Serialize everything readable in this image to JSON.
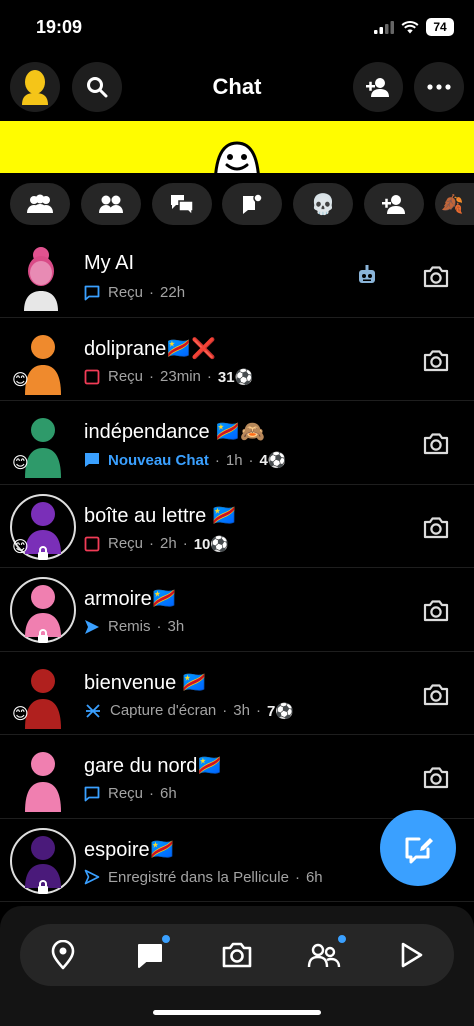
{
  "status_bar": {
    "time": "19:09",
    "battery": "74"
  },
  "header": {
    "title": "Chat"
  },
  "filters": [
    "groups-icon",
    "friends-icon",
    "unread-icon",
    "stories-icon",
    "skull-icon",
    "add-friend-icon",
    "more-filter-icon"
  ],
  "chats": [
    {
      "name": "My AI",
      "status_icon": "received-chat-outline",
      "status": "Reçu",
      "time": "22h",
      "streak": ""
    },
    {
      "name": "dolipranе🇨🇩❌",
      "status_icon": "received-snap-outline",
      "status": "Reçu",
      "time": "23min",
      "streak": "31⚽"
    },
    {
      "name": "indépendance 🇨🇩🙈",
      "status_icon": "new-chat-filled",
      "status": "Nouveau Chat",
      "time": "1h",
      "streak": "4⚽"
    },
    {
      "name": "boîte au lettre 🇨🇩",
      "status_icon": "received-snap-outline",
      "status": "Reçu",
      "time": "2h",
      "streak": "10⚽"
    },
    {
      "name": "armoire🇨🇩",
      "status_icon": "sent-chat-filled",
      "status": "Remis",
      "time": "3h",
      "streak": ""
    },
    {
      "name": "bienvenue 🇨🇩",
      "status_icon": "screenshot-chat",
      "status": "Capture d'écran",
      "time": "3h",
      "streak": "7⚽"
    },
    {
      "name": "gare du nord🇨🇩",
      "status_icon": "received-chat-outline",
      "status": "Reçu",
      "time": "6h",
      "streak": ""
    },
    {
      "name": "espoire🇨🇩",
      "status_icon": "sent-chat-outline",
      "status": "Enregistré dans la Pellicule",
      "time": "6h",
      "streak": ""
    }
  ],
  "bottom_nav": [
    "map-icon",
    "chat-icon",
    "camera-icon",
    "stories-icon",
    "spotlight-icon"
  ],
  "colors": {
    "accent": "#3aa0ff",
    "banner": "#fffc00",
    "snap_red": "#f23c57"
  }
}
